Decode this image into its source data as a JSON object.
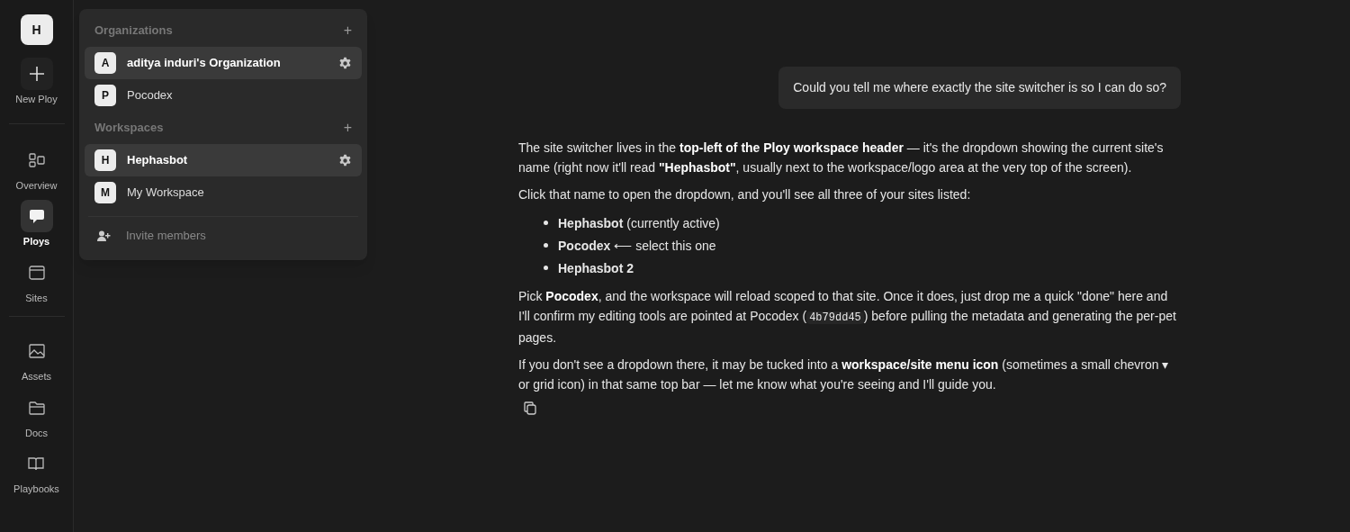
{
  "rail": {
    "avatar": "H",
    "items": [
      {
        "kind": "new",
        "label": "New Ploy",
        "selected": false
      },
      {
        "kind": "overview",
        "label": "Overview",
        "selected": false
      },
      {
        "kind": "ploys",
        "label": "Ploys",
        "selected": true
      },
      {
        "kind": "sites",
        "label": "Sites",
        "selected": false
      },
      {
        "kind": "assets",
        "label": "Assets",
        "selected": false
      },
      {
        "kind": "docs",
        "label": "Docs",
        "selected": false
      },
      {
        "kind": "playbooks",
        "label": "Playbooks",
        "selected": false
      }
    ]
  },
  "switcher": {
    "sections": [
      {
        "title": "Organizations",
        "add": "+",
        "items": [
          {
            "initial": "A",
            "name": "aditya induri's Organization",
            "selected": true
          },
          {
            "initial": "P",
            "name": "Pocodex",
            "selected": false
          }
        ]
      },
      {
        "title": "Workspaces",
        "add": "+",
        "items": [
          {
            "initial": "H",
            "name": "Hephasbot",
            "selected": true
          },
          {
            "initial": "M",
            "name": "My Workspace",
            "selected": false
          }
        ]
      }
    ],
    "invite": "Invite members"
  },
  "chat": {
    "user_message": "Could you tell me where exactly the site switcher is so I can do so?",
    "reply": [
      {
        "kind": "para",
        "parts": [
          {
            "kind": "text",
            "text": "The site switcher lives in the **top-left of the Ploy workspace header** — it's the dropdown showing the current site's name (right now it'll read **\"Hephasbot\"**, usually next to the workspace/logo area at the very top of the screen)."
          }
        ]
      },
      {
        "kind": "para",
        "parts": [
          {
            "kind": "text",
            "text": "Click that name to open the dropdown, and you'll see all three of your sites listed:"
          }
        ]
      },
      {
        "kind": "list",
        "items": [
          "**Hephasbot** (currently active)",
          "**Pocodex** ⟵ select this one",
          "**Hephasbot 2**"
        ]
      },
      {
        "kind": "para",
        "parts": [
          {
            "kind": "text",
            "text": "Pick **Pocodex**, and the workspace will reload scoped to that site. Once it does, just drop me a quick \"done\" here and I'll confirm my editing tools are pointed at Pocodex ("
          },
          {
            "kind": "code",
            "text": "4b79dd45"
          },
          {
            "kind": "text",
            "text": ") before pulling the metadata and generating the per-pet pages."
          }
        ]
      },
      {
        "kind": "para",
        "parts": [
          {
            "kind": "text",
            "text": "If you don't see a dropdown there, it may be tucked into a **workspace/site menu icon** (sometimes a small chevron ▾ or grid icon) in that same top bar — let me know what you're seeing and I'll guide you."
          }
        ]
      }
    ]
  }
}
